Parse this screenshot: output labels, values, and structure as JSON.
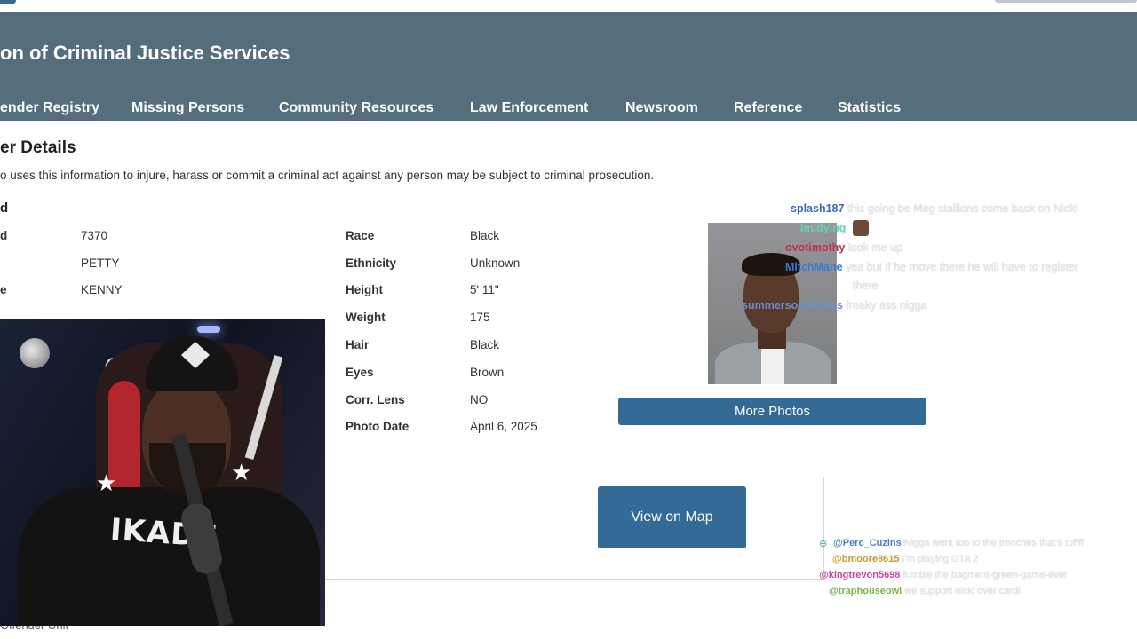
{
  "header": {
    "site_title": "on of Criminal Justice Services",
    "nav": [
      "ender Registry",
      "Missing Persons",
      "Community Resources",
      "Law Enforcement",
      "Newsroom",
      "Reference",
      "Statistics"
    ]
  },
  "page": {
    "section_title": "er Details",
    "warning": "o uses this information to injure, harass or commit a criminal act against any person may be subject to criminal prosecution.",
    "sub_heading": "d",
    "left_fields": [
      {
        "label": "d",
        "value": "7370"
      },
      {
        "label": "",
        "value": "PETTY"
      },
      {
        "label": "e",
        "value": "KENNY"
      }
    ],
    "right_fields": [
      {
        "label": "Race",
        "value": "Black"
      },
      {
        "label": "Ethnicity",
        "value": "Unknown"
      },
      {
        "label": "Height",
        "value": "5' 11\""
      },
      {
        "label": "Weight",
        "value": "175"
      },
      {
        "label": "Hair",
        "value": "Black"
      },
      {
        "label": "Eyes",
        "value": "Brown"
      },
      {
        "label": "Corr. Lens",
        "value": "NO"
      },
      {
        "label": "Photo Date",
        "value": "April 6, 2025"
      }
    ],
    "more_photos_label": "More Photos",
    "view_map_label": "View on Map",
    "footer_text": "Offender Unit"
  },
  "webcam": {
    "jersey_text": "IKADE"
  },
  "twitch_chat": [
    {
      "user": "splash187",
      "color": "#3a66b8",
      "message": "this going be Meg stallions come back on Nicki"
    },
    {
      "user": "Imidying",
      "color": "#6fd0b0",
      "message": "",
      "emote": "face-emote-icon"
    },
    {
      "user": "ovotimothy",
      "color": "#c42f4f",
      "message": "look me up"
    },
    {
      "user": "MitchMane",
      "color": "#3a7ad4",
      "message": "yea but if he move there he will have to register"
    },
    {
      "user": "",
      "color": "#3a7ad4",
      "message": "there"
    },
    {
      "user": "summersometimes",
      "color": "#6a8ed4",
      "message": "freaky ass nigga"
    }
  ],
  "kick_chat": [
    {
      "user": "@Perc_Cuzins",
      "color": "#4c7fc4",
      "message": "Nigga went too to the trenches that's tuffff"
    },
    {
      "user": "@bmoore8615",
      "color": "#c79a2e",
      "message": "I'm playing GTA 2"
    },
    {
      "user": "@kingtrevon5698",
      "color": "#c447a3",
      "message": "fumble the bagment-green-game-ever"
    },
    {
      "user": "@traphouseowl",
      "color": "#7cb342",
      "message": "we support nicki over cardi"
    }
  ]
}
